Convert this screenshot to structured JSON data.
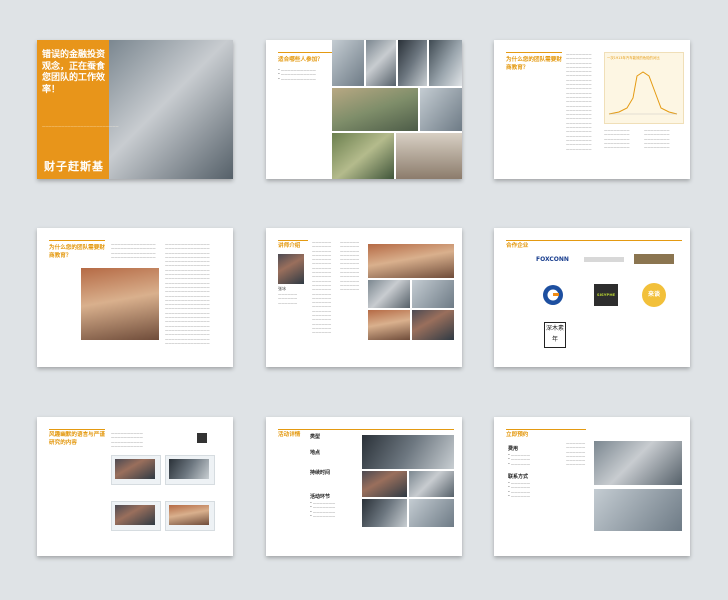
{
  "page1": {
    "title": "错误的金融投资观念，正在蚕食您团队的工作效率！",
    "brand_logo": "财子赶斯基"
  },
  "page2": {
    "heading": "适合哪些人参加？"
  },
  "page3": {
    "heading": "为什么您的团队需要财商教育？",
    "chart_title": "一次1913年汽车能效的危险的对比"
  },
  "page4": {
    "heading": "为什么您的团队需要财商教育？"
  },
  "page5": {
    "heading": "讲师介绍",
    "instructor_name": "张冰"
  },
  "page6": {
    "heading": "合作企业",
    "logos": [
      {
        "name": "FOXCONN"
      },
      {
        "name": "SISYPHE"
      },
      {
        "name": "来谈"
      },
      {
        "name": "深木素年"
      }
    ]
  },
  "page7": {
    "heading": "风趣幽默的语言与严谨研究的内容"
  },
  "page8": {
    "heading": "活动详情",
    "labels": [
      "类型",
      "地点",
      "持续时间",
      "活动环节"
    ]
  },
  "page9": {
    "heading": "立即预约",
    "labels": [
      "费用",
      "联系方式"
    ]
  },
  "colors": {
    "accent": "#e49a12",
    "background": "#dfe3e6"
  }
}
